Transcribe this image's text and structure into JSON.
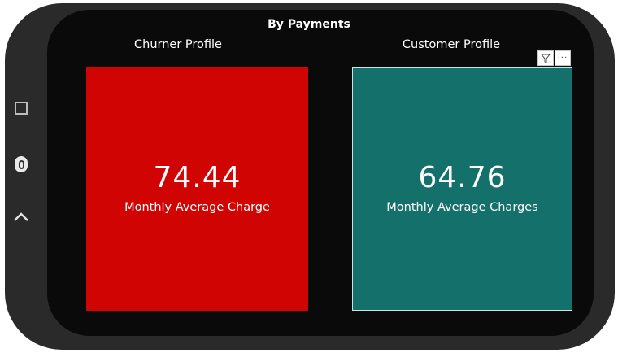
{
  "report": {
    "title": "By Payments"
  },
  "cards": {
    "churner": {
      "heading": "Churner Profile",
      "value": "74.44",
      "label": "Monthly Average Charge",
      "color": "#d10404"
    },
    "customer": {
      "heading": "Customer Profile",
      "value": "64.76",
      "label": "Monthly Average Charges",
      "color": "#14706a"
    }
  },
  "toolbar": {
    "filter_icon": "filter-icon",
    "more_label": "···"
  },
  "device_controls": {
    "icons": [
      "square-icon",
      "home-icon",
      "chevron-up-icon",
      "chevron-left-icon"
    ]
  }
}
